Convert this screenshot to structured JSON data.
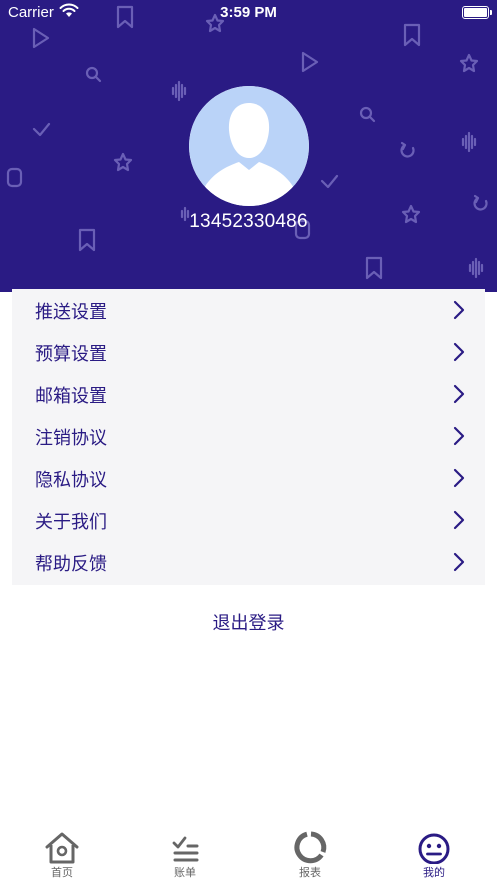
{
  "status_bar": {
    "carrier": "Carrier",
    "time": "3:59 PM"
  },
  "profile": {
    "phone": "13452330486"
  },
  "settings": {
    "items": [
      {
        "label": "推送设置",
        "icon": "chevron-right-icon"
      },
      {
        "label": "预算设置",
        "icon": "chevron-right-icon"
      },
      {
        "label": "邮箱设置",
        "icon": "chevron-right-icon"
      },
      {
        "label": "注销协议",
        "icon": "chevron-right-icon"
      },
      {
        "label": "隐私协议",
        "icon": "chevron-right-icon"
      },
      {
        "label": "关于我们",
        "icon": "chevron-right-icon"
      },
      {
        "label": "帮助反馈",
        "icon": "chevron-right-icon"
      }
    ]
  },
  "logout": {
    "label": "退出登录"
  },
  "tabbar": {
    "tabs": [
      {
        "label": "首页",
        "icon": "home-icon"
      },
      {
        "label": "账单",
        "icon": "checklist-icon"
      },
      {
        "label": "报表",
        "icon": "ring-chart-icon"
      },
      {
        "label": "我的",
        "icon": "smiley-face-icon",
        "active": true
      }
    ]
  },
  "colors": {
    "primary": "#2a1b84",
    "avatar_bg": "#bad3f8",
    "list_bg": "#f5f5f7",
    "tab_inactive": "#666666"
  }
}
